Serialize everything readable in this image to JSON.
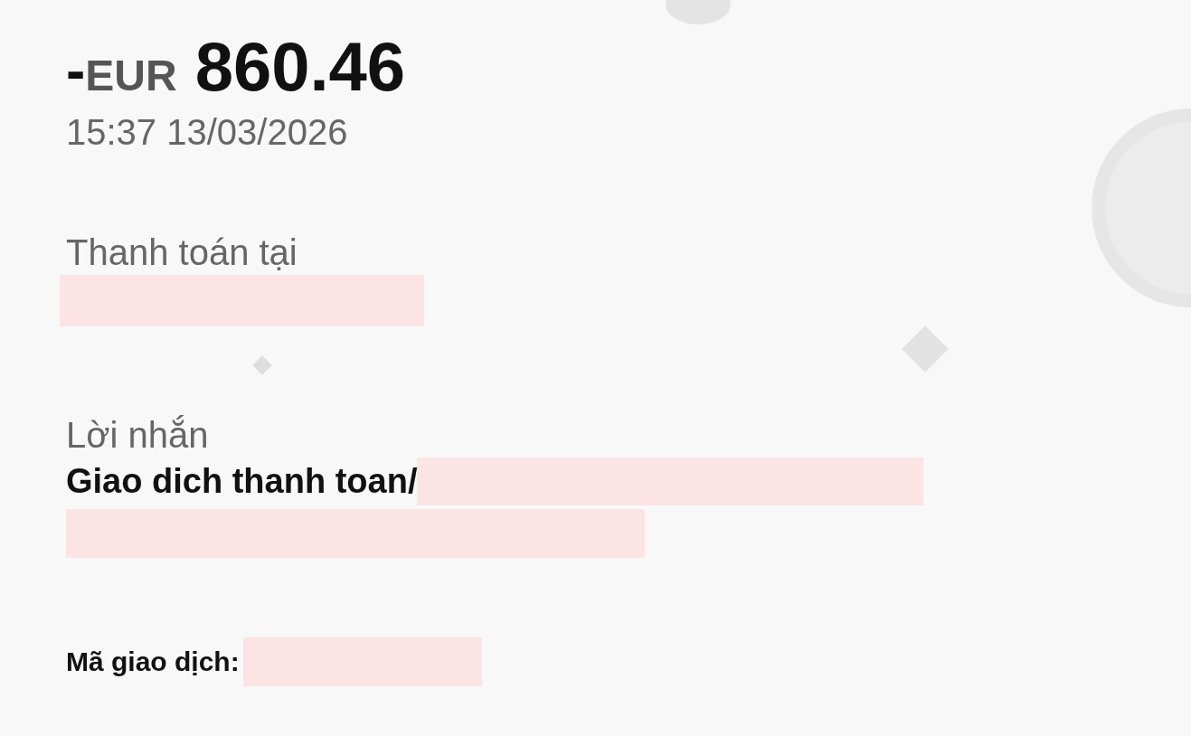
{
  "amount": {
    "sign": "-",
    "currency": "EUR",
    "value": "860.46"
  },
  "datetime": "15:37 13/03/2026",
  "paid_at": {
    "label": "Thanh toán tại"
  },
  "message": {
    "label": "Lời nhắn",
    "text": "Giao dich thanh toan/"
  },
  "transaction_id": {
    "label": "Mã giao dịch:"
  }
}
